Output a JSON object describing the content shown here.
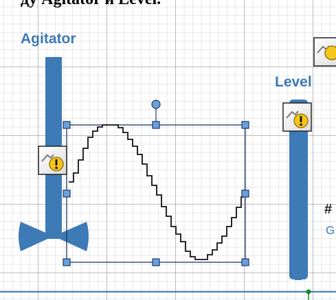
{
  "canvas": {
    "caption_text": "ду Agitator и Level.",
    "agitator": {
      "label": "Agitator"
    },
    "level": {
      "label": "Level"
    },
    "clipped_text_top": "#",
    "clipped_text_bottom": "G"
  },
  "icons": {
    "warning_badge": "warning-badge-icon",
    "rotation_handle": "rotate-handle-icon",
    "selection_handle": "resize-handle-icon",
    "connection_point": "connection-point-icon"
  },
  "colors": {
    "accent_blue": "#3d7ab6",
    "handle_fill": "#6aa0dd",
    "warning_yellow": "#f4c51a",
    "selection_line": "#1f3864",
    "trend_line": "#111111",
    "green_point": "#1a8a2a"
  }
}
